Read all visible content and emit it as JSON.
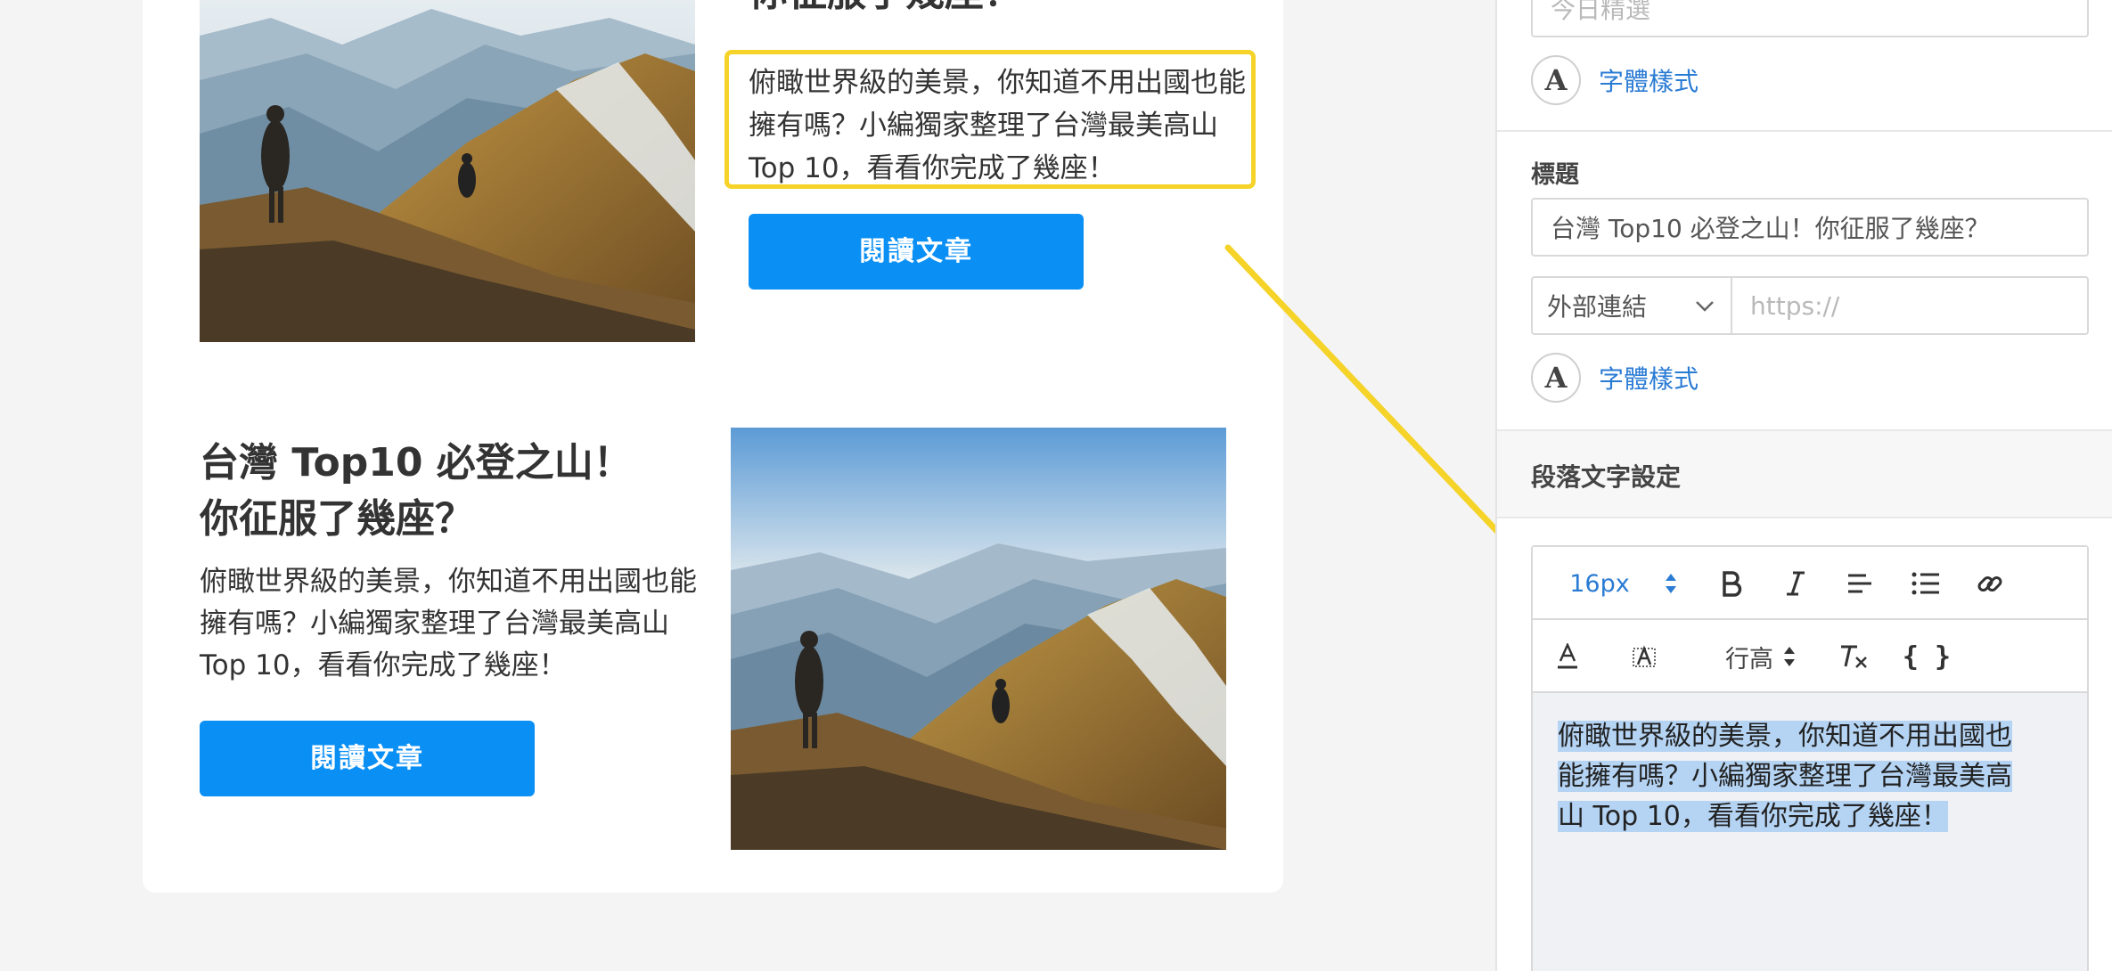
{
  "canvas": {
    "article_top": {
      "title_partial": "你征服了幾座？",
      "description": "俯瞰世界級的美景，你知道不用出國也能擁有嗎？小編獨家整理了台灣最美高山 Top 10，看看你完成了幾座！",
      "button_label": "閱讀文章"
    },
    "article_bottom": {
      "title_line1": "台灣 Top10 必登之山！",
      "title_line2": "你征服了幾座？",
      "description": "俯瞰世界級的美景，你知道不用出國也能擁有嗎？小編獨家整理了台灣最美高山 Top 10，看看你完成了幾座！",
      "button_label": "閱讀文章"
    }
  },
  "panel": {
    "subtitle_placeholder": "今日精選",
    "font_style_label_1": "字體樣式",
    "title_section_label": "標題",
    "title_value": "台灣 Top10 必登之山！你征服了幾座？",
    "link_type": "外部連結",
    "url_placeholder": "https://",
    "font_style_label_2": "字體樣式",
    "paragraph_section_label": "段落文字設定",
    "toolbar": {
      "font_size": "16px",
      "line_height_label": "行高"
    },
    "editor_text_line1": "俯瞰世界級的美景，你知道不用出國也",
    "editor_text_line2": "能擁有嗎？小編獨家整理了台灣最美高",
    "editor_text_line3": "山 Top 10，看看你完成了幾座！"
  },
  "colors": {
    "button_blue": "#0a8ff5",
    "highlight_yellow": "#f5d328",
    "link_blue": "#2a7bd4",
    "selection_blue": "#b5d4f4"
  }
}
